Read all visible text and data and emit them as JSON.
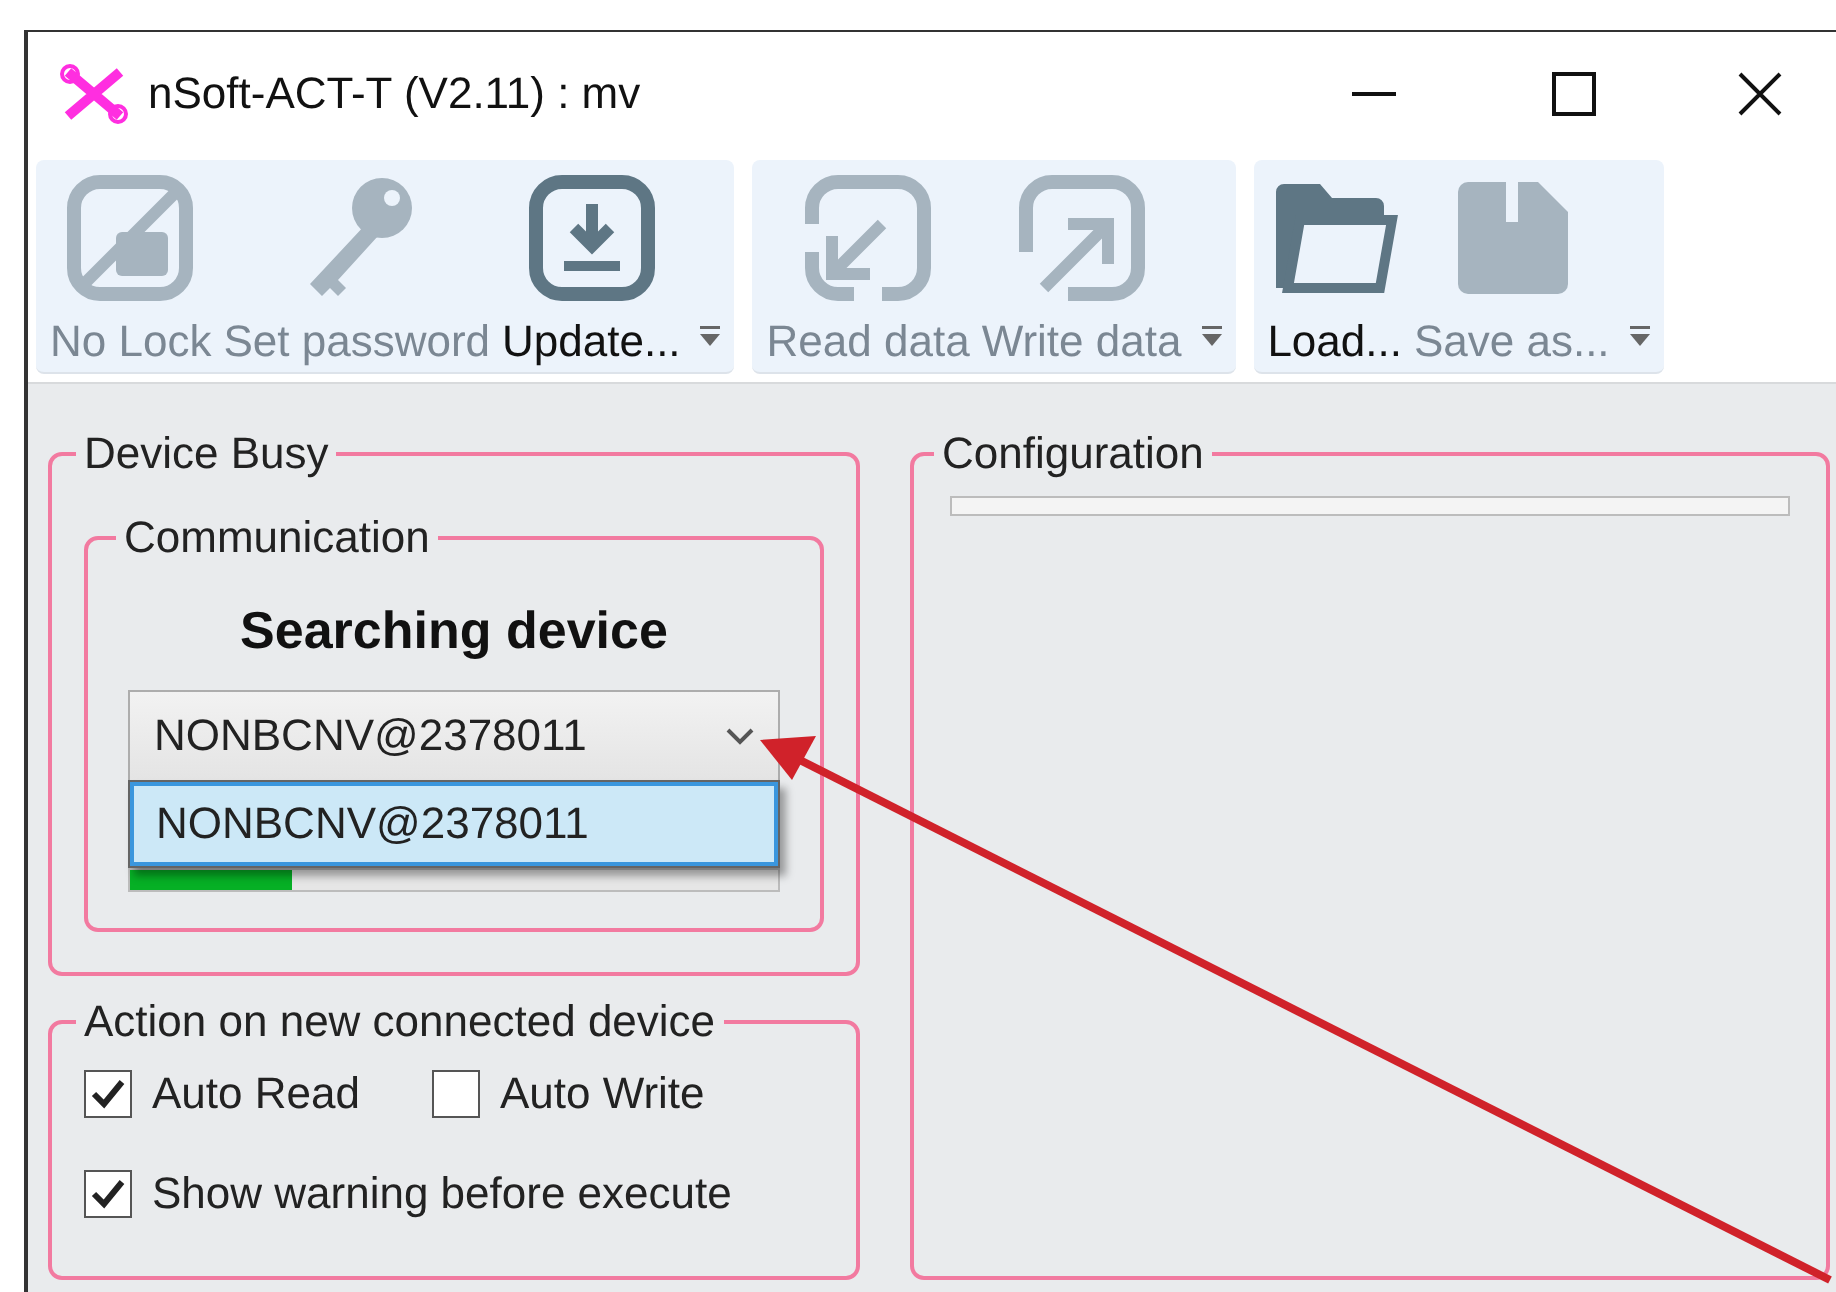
{
  "window": {
    "title": "nSoft-ACT-T (V2.11) : mv"
  },
  "toolbar": {
    "groups": [
      {
        "buttons": [
          {
            "kind": "nolock",
            "label": "No Lock",
            "enabled": false
          },
          {
            "kind": "key",
            "label": "Set password",
            "enabled": false
          },
          {
            "kind": "download",
            "label": "Update...",
            "enabled": true
          }
        ]
      },
      {
        "buttons": [
          {
            "kind": "read",
            "label": "Read data",
            "enabled": false
          },
          {
            "kind": "write",
            "label": "Write data",
            "enabled": false
          }
        ]
      },
      {
        "buttons": [
          {
            "kind": "folder",
            "label": "Load...",
            "enabled": true
          },
          {
            "kind": "save",
            "label": "Save as...",
            "enabled": false
          }
        ]
      }
    ]
  },
  "device_busy": {
    "title": "Device Busy",
    "communication": {
      "title": "Communication",
      "status": "Searching device",
      "device_select": {
        "value": "NONBCNV@2378011",
        "expanded": true,
        "options": [
          {
            "label": "NONBCNV@2378011",
            "selected": true
          }
        ]
      },
      "progress": {
        "level": 0.25
      }
    }
  },
  "action_group": {
    "title": "Action on new connected device",
    "rows": [
      [
        {
          "label": "Auto Read",
          "checked": true
        },
        {
          "label": "Auto Write",
          "checked": false
        }
      ],
      [
        {
          "label": "Show warning before execute",
          "checked": true
        }
      ]
    ]
  },
  "configuration": {
    "title": "Configuration",
    "progress": {
      "level": 0
    }
  }
}
